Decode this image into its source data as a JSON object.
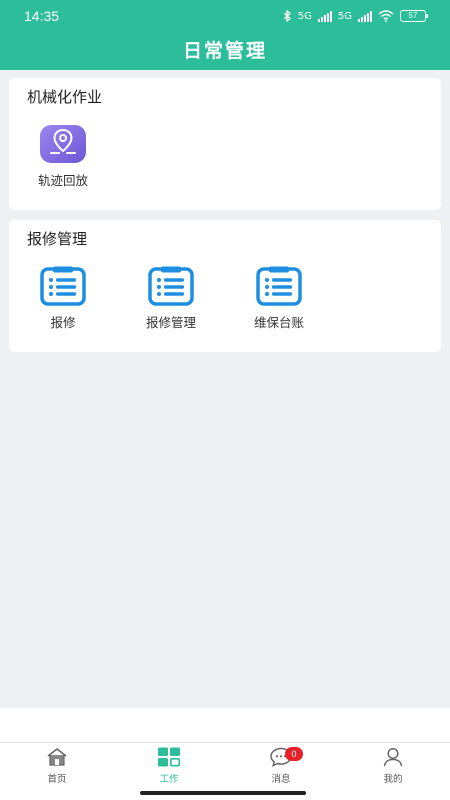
{
  "status_bar": {
    "time": "14:35",
    "network_1": "5G",
    "network_2": "5G",
    "battery": "57"
  },
  "header": {
    "title": "日常管理"
  },
  "section_mechanized": {
    "title": "机械化作业",
    "items": [
      {
        "label": "轨迹回放",
        "icon": "location-pin-icon"
      }
    ]
  },
  "section_repair": {
    "title": "报修管理",
    "items": [
      {
        "label": "报修",
        "icon": "clipboard-list-icon"
      },
      {
        "label": "报修管理",
        "icon": "clipboard-list-icon"
      },
      {
        "label": "维保台账",
        "icon": "clipboard-list-icon"
      }
    ]
  },
  "tabbar": {
    "tabs": [
      {
        "label": "首页",
        "icon": "home-icon"
      },
      {
        "label": "工作",
        "icon": "grid-icon"
      },
      {
        "label": "消息",
        "icon": "chat-icon",
        "badge": "0"
      },
      {
        "label": "我的",
        "icon": "user-icon"
      }
    ],
    "active_index": 1
  },
  "colors": {
    "primary": "#2cbd9a",
    "icon_blue": "#1e8fe0",
    "badge_red": "#e8202a",
    "background": "#eff0f4"
  }
}
